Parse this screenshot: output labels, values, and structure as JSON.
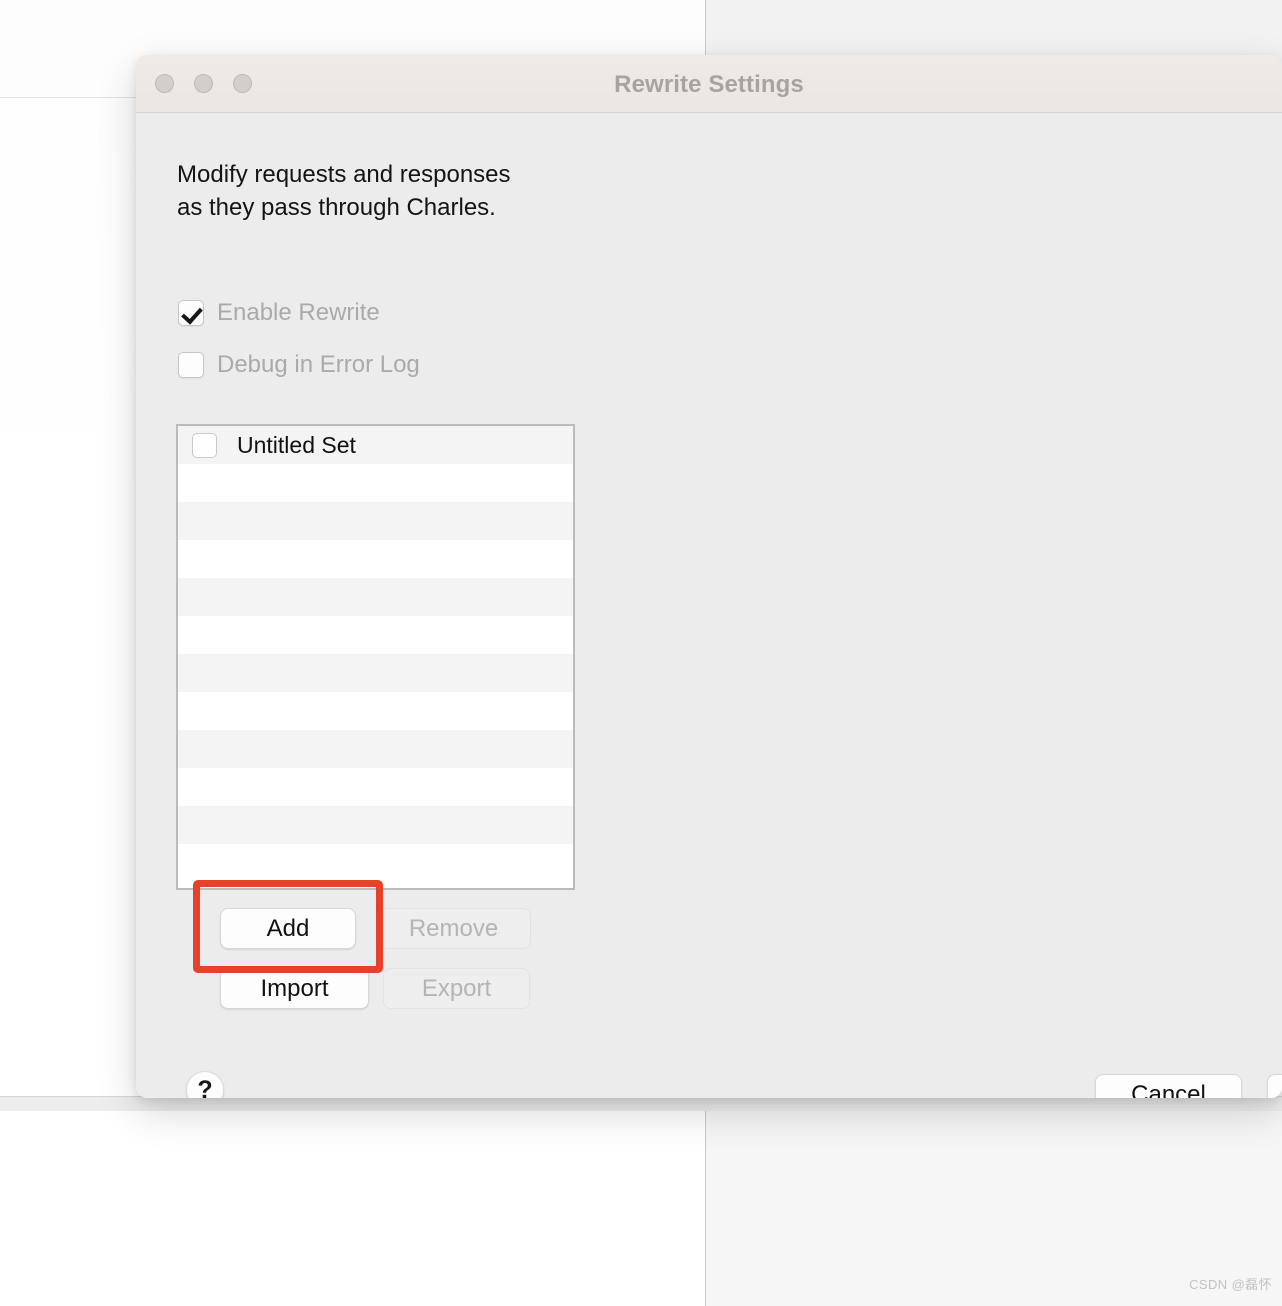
{
  "window": {
    "title": "Rewrite Settings",
    "traffic_lights": [
      "close-button",
      "minimize-button",
      "zoom-button"
    ]
  },
  "content": {
    "description": "Modify requests and responses\nas they pass through Charles.",
    "checkboxes": [
      {
        "label": "Enable Rewrite",
        "checked": true,
        "enabled": false
      },
      {
        "label": "Debug in Error Log",
        "checked": false,
        "enabled": false
      }
    ],
    "list": {
      "rows": [
        {
          "label": "Untitled Set",
          "checked": false
        },
        {
          "label": "",
          "checked": false
        },
        {
          "label": "",
          "checked": false
        },
        {
          "label": "",
          "checked": false
        },
        {
          "label": "",
          "checked": false
        },
        {
          "label": "",
          "checked": false
        },
        {
          "label": "",
          "checked": false
        },
        {
          "label": "",
          "checked": false
        },
        {
          "label": "",
          "checked": false
        },
        {
          "label": "",
          "checked": false
        },
        {
          "label": "",
          "checked": false
        },
        {
          "label": "",
          "checked": false
        }
      ]
    },
    "buttons": {
      "add": "Add",
      "remove": "Remove",
      "import": "Import",
      "export": "Export",
      "help": "?",
      "cancel": "Cancel",
      "ok": ""
    }
  },
  "annotation": {
    "target": "add-button",
    "color": "#e8412a"
  },
  "watermark": "CSDN @磊怀"
}
